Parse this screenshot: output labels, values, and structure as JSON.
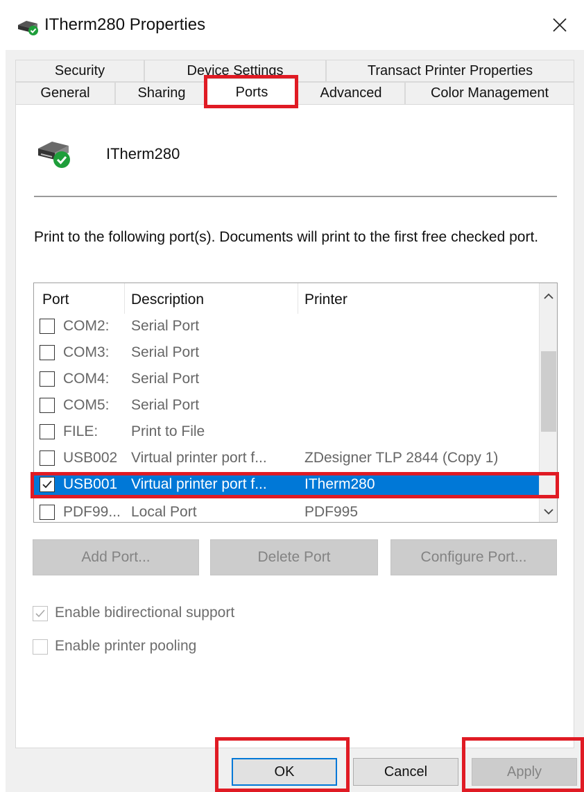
{
  "window": {
    "title": "ITherm280 Properties",
    "title_icon": "printer-icon",
    "close_icon": "close-icon"
  },
  "tabs": {
    "row1": [
      "Security",
      "Device Settings",
      "Transact Printer Properties"
    ],
    "row2": [
      "General",
      "Sharing",
      "Ports",
      "Advanced",
      "Color Management"
    ],
    "active": "Ports"
  },
  "printer": {
    "name": "ITherm280",
    "icon": "printer-ready-icon"
  },
  "description": "Print to the following port(s). Documents will print to the first free checked port.",
  "ports_table": {
    "columns": [
      "Port",
      "Description",
      "Printer"
    ],
    "rows": [
      {
        "port": "COM2:",
        "description": "Serial Port",
        "printer": "",
        "checked": false,
        "selected": false
      },
      {
        "port": "COM3:",
        "description": "Serial Port",
        "printer": "",
        "checked": false,
        "selected": false
      },
      {
        "port": "COM4:",
        "description": "Serial Port",
        "printer": "",
        "checked": false,
        "selected": false
      },
      {
        "port": "COM5:",
        "description": "Serial Port",
        "printer": "",
        "checked": false,
        "selected": false
      },
      {
        "port": "FILE:",
        "description": "Print to File",
        "printer": "",
        "checked": false,
        "selected": false
      },
      {
        "port": "USB002",
        "description": "Virtual printer port f...",
        "printer": "ZDesigner TLP 2844 (Copy 1)",
        "checked": false,
        "selected": false
      },
      {
        "port": "USB001",
        "description": "Virtual printer port f...",
        "printer": "ITherm280",
        "checked": true,
        "selected": true
      },
      {
        "port": "PDF99...",
        "description": "Local Port",
        "printer": "PDF995",
        "checked": false,
        "selected": false
      }
    ]
  },
  "port_buttons": {
    "add": "Add Port...",
    "delete": "Delete Port",
    "configure": "Configure Port..."
  },
  "options": {
    "bidirectional": {
      "label": "Enable bidirectional support",
      "checked": true,
      "enabled": false
    },
    "pooling": {
      "label": "Enable printer pooling",
      "checked": false,
      "enabled": true
    }
  },
  "footer": {
    "ok": "OK",
    "cancel": "Cancel",
    "apply": "Apply"
  },
  "colors": {
    "selection": "#0078d7",
    "highlight": "#e01b24",
    "dialog_bg": "#f0f0f0"
  }
}
